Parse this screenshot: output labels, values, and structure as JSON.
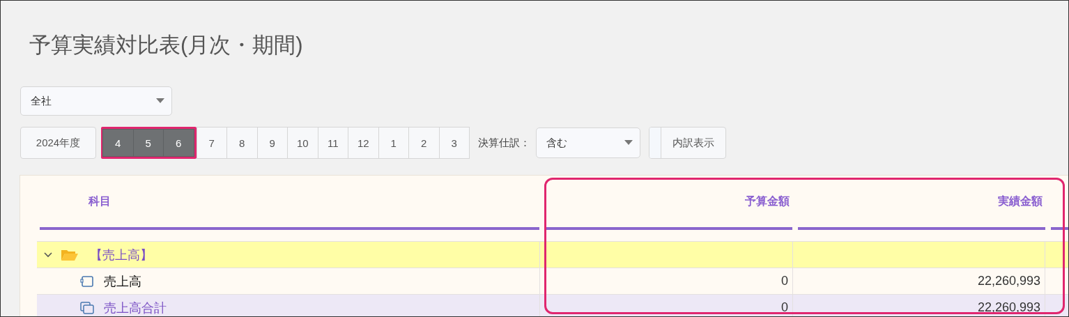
{
  "title": "予算実績対比表(月次・期間)",
  "department_select": {
    "value": "全社"
  },
  "fiscal_year": "2024年度",
  "months": [
    {
      "label": "4",
      "selected": true
    },
    {
      "label": "5",
      "selected": true
    },
    {
      "label": "6",
      "selected": true
    },
    {
      "label": "7",
      "selected": false
    },
    {
      "label": "8",
      "selected": false
    },
    {
      "label": "9",
      "selected": false
    },
    {
      "label": "10",
      "selected": false
    },
    {
      "label": "11",
      "selected": false
    },
    {
      "label": "12",
      "selected": false
    },
    {
      "label": "1",
      "selected": false
    },
    {
      "label": "2",
      "selected": false
    },
    {
      "label": "3",
      "selected": false
    }
  ],
  "closing_entries": {
    "label": "決算仕訳：",
    "value": "含む"
  },
  "breakdown_button": "内訳表示",
  "table": {
    "columns": [
      "科目",
      "予算金額",
      "実績金額"
    ],
    "rows": [
      {
        "kind": "group",
        "label": "【売上高】",
        "expanded": true
      },
      {
        "kind": "item",
        "label": "売上高",
        "budget": "0",
        "actual": "22,260,993"
      },
      {
        "kind": "total",
        "label": "売上高合計",
        "budget": "0",
        "actual": "22,260,993"
      }
    ]
  }
}
